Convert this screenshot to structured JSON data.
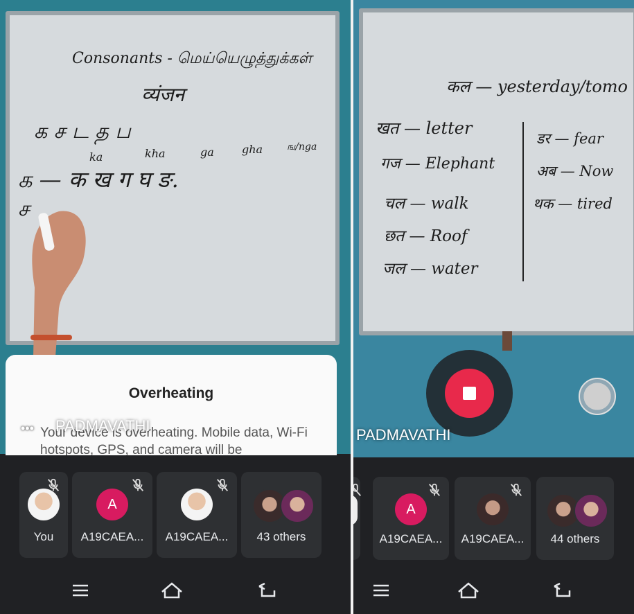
{
  "left_screen": {
    "board_lines": {
      "l1": "Consonants - மெய்யெழுத்துக்கள்",
      "l2": "व्यंजन",
      "l3": "க  ச  ட  த  ப",
      "l4a": "ka",
      "l4b": "kha",
      "l4c": "ga",
      "l4d": "gha",
      "l4e": "ங/nga",
      "l5": "க — क  ख  ग  घ  ङ.",
      "l6": "ச"
    },
    "dialog": {
      "title": "Overheating",
      "body": "Your device is overheating. Mobile data, Wi-Fi hotspots, GPS, and camera will be"
    },
    "presenter_name": "PADMAVATHI",
    "participants": [
      {
        "label": "You",
        "kind": "photo"
      },
      {
        "label": "A19CAEA...",
        "kind": "letter",
        "initial": "A"
      },
      {
        "label": "A19CAEA...",
        "kind": "photo"
      },
      {
        "label": "43 others",
        "kind": "pair"
      }
    ]
  },
  "right_screen": {
    "board_lines": {
      "top": "कल — yesterday/tomo",
      "r1": "खत — letter",
      "r2": "गज — Elephant",
      "r3": "चल — walk",
      "r4": "छत — Roof",
      "r5": "जल — water",
      "c1": "डर — fear",
      "c2": "अब — Now",
      "c3": "थक — tired"
    },
    "presenter_name": "PADMAVATHI",
    "participants": [
      {
        "label": "A19CAEA...",
        "kind": "letter",
        "initial": "A"
      },
      {
        "label": "A19CAEA...",
        "kind": "photo"
      },
      {
        "label": "44 others",
        "kind": "pair"
      }
    ]
  },
  "navbar": {
    "icons": [
      "menu-icon",
      "home-icon",
      "back-icon"
    ]
  },
  "colors": {
    "accent_record": "#e8294b",
    "avatar_letter": "#d81b60",
    "tile": "#2e3033",
    "bg": "#202124"
  }
}
